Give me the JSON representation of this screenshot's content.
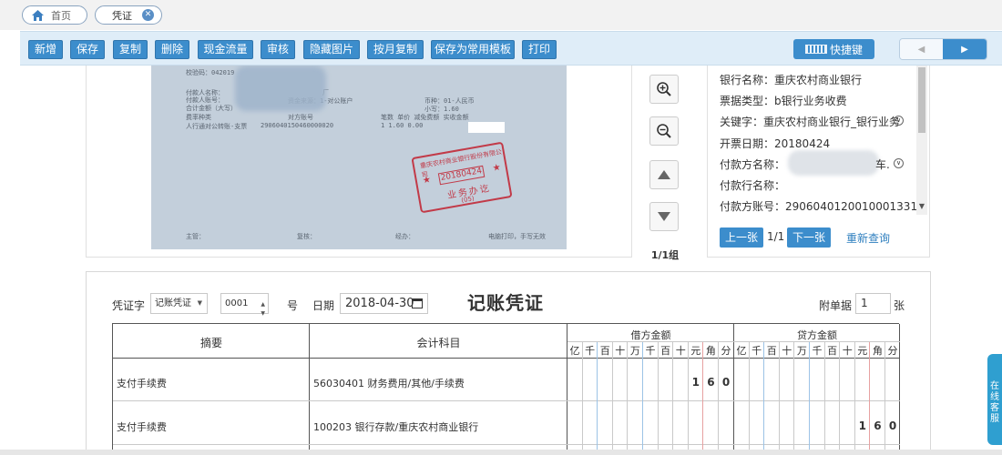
{
  "tabs": [
    {
      "label": "首页"
    },
    {
      "label": "凭证",
      "close": "✕"
    }
  ],
  "toolbar": {
    "buttons": [
      "新增",
      "保存",
      "复制",
      "删除",
      "现金流量",
      "审核",
      "隐藏图片",
      "按月复制",
      "保存为常用模板",
      "打印"
    ],
    "shortcut_label": "快捷键",
    "prev_arrow": "◀",
    "next_arrow": "▶"
  },
  "scan": {
    "lines": [
      "校验码：042019",
      "付款人名称：",
      "付款人账号：",
      "合计金额（大写）",
      "费率种类",
      "人行通对公转账-支票"
    ],
    "mid_lines": [
      "厂",
      "资金来源：1-对公账户",
      "对方账号",
      "2906040150460000020"
    ],
    "right_lines": [
      "币种：01-人民币",
      "小写：1.60",
      "笔数  单价     减免费额  实收金额",
      "1     1.60     0.00"
    ],
    "footer": [
      "主管：",
      "复核：",
      "经办：",
      "电脑打印，手写无效"
    ],
    "stamp": {
      "top": "重庆农村商业银行股份有限公司",
      "date": "20180424",
      "bottom": "业务办讫",
      "sub": "(05)",
      "star": "★"
    }
  },
  "viewer": {
    "page_count": "1/1组"
  },
  "info": {
    "rows": [
      {
        "label": "银行名称：",
        "value": "重庆农村商业银行"
      },
      {
        "label": "票据类型：",
        "value": "b银行业务收费"
      },
      {
        "label": "关键字：",
        "value": "重庆农村商业银行_银行业务"
      },
      {
        "label": "开票日期：",
        "value": "20180424"
      },
      {
        "label": "付款方名称：",
        "value": "车."
      },
      {
        "label": "付款行名称：",
        "value": ""
      },
      {
        "label": "付款方账号：",
        "value": "2906040120010001331"
      }
    ],
    "prev_label": "上一张",
    "page": "1/1",
    "next_label": "下一张",
    "requery_label": "重新查询",
    "expand_glyph": "∨",
    "scroll_down": "▼"
  },
  "voucher": {
    "type_label": "凭证字",
    "type_value": "记账凭证",
    "caret": "▼",
    "number": "0001",
    "number_suffix": "号",
    "up": "▲",
    "down": "▼",
    "date_label": "日期",
    "date_value": "2018-04-30",
    "title": "记账凭证",
    "attach_label": "附单据",
    "attach_value": "1",
    "attach_unit": "张",
    "headers": {
      "summary": "摘要",
      "account": "会计科目",
      "debit": "借方金额",
      "credit": "贷方金额"
    },
    "digit_units": [
      "亿",
      "千",
      "百",
      "十",
      "万",
      "千",
      "百",
      "十",
      "元",
      "角",
      "分"
    ],
    "rows": [
      {
        "summary": "支付手续费",
        "account": "56030401 财务费用/其他/手续费",
        "debit": [
          "1",
          "6",
          "0"
        ],
        "credit": []
      },
      {
        "summary": "支付手续费",
        "account": "100203 银行存款/重庆农村商业银行",
        "debit": [],
        "credit": [
          "1",
          "6",
          "0"
        ]
      }
    ]
  },
  "side_widget": {
    "text": "在线客服"
  }
}
